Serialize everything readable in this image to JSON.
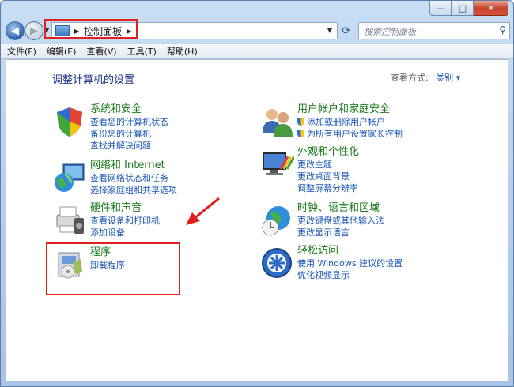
{
  "address": {
    "crumb": "控制面板"
  },
  "search": {
    "placeholder": "搜索控制面板"
  },
  "menu": [
    "文件(F)",
    "编辑(E)",
    "查看(V)",
    "工具(T)",
    "帮助(H)"
  ],
  "page": {
    "title": "调整计算机的设置",
    "view_by_label": "查看方式:",
    "view_by_value": "类别"
  },
  "categories": {
    "system": {
      "title": "系统和安全",
      "links": [
        "查看您的计算机状态",
        "备份您的计算机",
        "查找并解决问题"
      ]
    },
    "network": {
      "title": "网络和 Internet",
      "links": [
        "查看网络状态和任务",
        "选择家庭组和共享选项"
      ]
    },
    "hardware": {
      "title": "硬件和声音",
      "links": [
        "查看设备和打印机",
        "添加设备"
      ]
    },
    "programs": {
      "title": "程序",
      "links": [
        "卸载程序"
      ]
    },
    "users": {
      "title": "用户帐户和家庭安全",
      "links": [
        "添加或删除用户帐户",
        "为所有用户设置家长控制"
      ]
    },
    "appearance": {
      "title": "外观和个性化",
      "links": [
        "更改主题",
        "更改桌面背景",
        "调整屏幕分辨率"
      ]
    },
    "clock": {
      "title": "时钟、语言和区域",
      "links": [
        "更改键盘或其他输入法",
        "更改显示语言"
      ]
    },
    "ease": {
      "title": "轻松访问",
      "links": [
        "使用 Windows 建议的设置",
        "优化视频显示"
      ]
    }
  },
  "colors": {
    "highlight": "#e11f1f",
    "link": "#1a55b5",
    "category_title": "#1d7a1d"
  }
}
